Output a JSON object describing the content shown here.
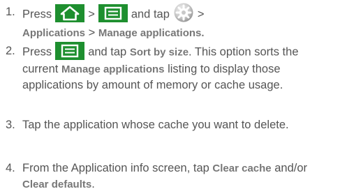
{
  "steps": [
    {
      "number": "1.",
      "press": "Press",
      "sep1": ">",
      "and_tap": "and tap",
      "sep2": ">",
      "path_a": "Applications",
      "sep3": ">",
      "path_b": "Manage applications."
    },
    {
      "number": "2.",
      "press": "Press",
      "and_tap": "and tap",
      "sort_label": "Sort by size",
      "text_a": ". This option sorts the current",
      "manage_label": "Manage applications",
      "text_b": "listing to display those applications by amount of memory or cache usage."
    },
    {
      "number": "3.",
      "text": "Tap the application whose cache you want to delete."
    },
    {
      "number": "4.",
      "text_a": "From the Application info screen, tap",
      "clear_cache": "Clear cache",
      "text_b": "and/or",
      "clear_defaults": "Clear defaults",
      "period": "."
    }
  ],
  "icons": {
    "home": "home-icon",
    "menu": "menu-icon",
    "settings": "settings-icon"
  },
  "colors": {
    "text": "#555555",
    "bold_text": "#777777",
    "icon_green": "#1e8f2f"
  }
}
